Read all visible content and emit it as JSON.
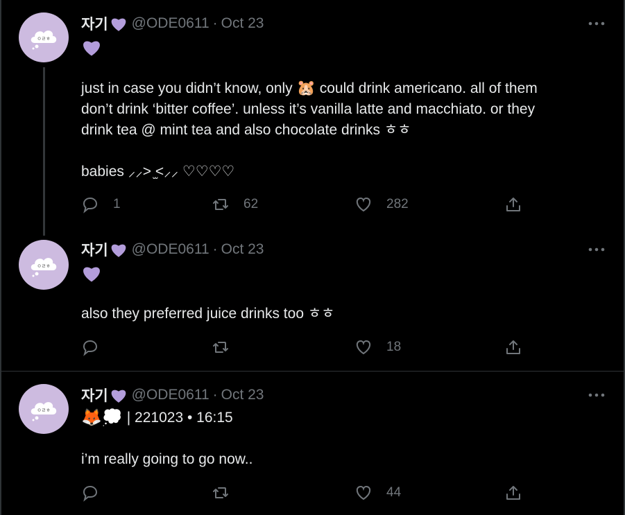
{
  "tweets": [
    {
      "name": "자기",
      "handle": "@ODE0611",
      "date": "Oct 23",
      "subline_icon": "purple-heart",
      "body_part1": "just in case you didn’t know, only ",
      "body_emoji": "🐹",
      "body_part2": " could drink americano. all of them\ndon’t drink ‘bitter coffee’. unless it’s vanilla latte and macchiato. or they\ndrink tea @ mint tea and also chocolate drinks ㅎㅎ\n\nbabies ⸝⸝> ̫<⸝⸝ ♡♡♡♡",
      "replies": "1",
      "retweets": "62",
      "likes": "282"
    },
    {
      "name": "자기",
      "handle": "@ODE0611",
      "date": "Oct 23",
      "subline_icon": "purple-heart",
      "body": "also they preferred juice drinks too ㅎㅎ",
      "replies": "",
      "retweets": "",
      "likes": "18"
    },
    {
      "name": "자기",
      "handle": "@ODE0611",
      "date": "Oct 23",
      "subline_emoji": "🦊💭",
      "subline_text": " | 221023 • 16:15",
      "body": "i’m really going to go now..",
      "replies": "",
      "retweets": "",
      "likes": "44"
    }
  ],
  "dot": "·",
  "colors": {
    "background": "#000000",
    "text": "#e7e9ea",
    "muted": "#71767b",
    "avatar": "#cdbbe0",
    "heart": "#b39ddb"
  }
}
